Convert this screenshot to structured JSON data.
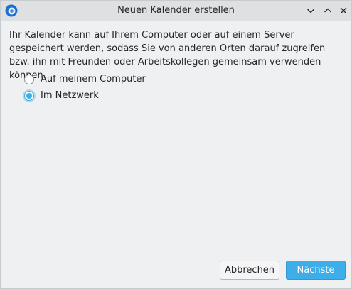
{
  "window": {
    "title": "Neuen Kalender erstellen",
    "app_icon": "thunderbird-icon"
  },
  "titlebar_buttons": {
    "minimize_icon": "chevron-down-icon",
    "maximize_icon": "chevron-up-icon",
    "close_icon": "close-icon"
  },
  "description": "Ihr Kalender kann auf Ihrem Computer oder auf einem Server gespeichert werden, sodass Sie von anderen Orten darauf zugreifen bzw. ihn mit Freunden oder Arbeitskollegen gemeinsam verwenden können.",
  "location_options": [
    {
      "label": "Auf meinem Computer",
      "checked": false
    },
    {
      "label": "Im Netzwerk",
      "checked": true
    }
  ],
  "buttons": {
    "cancel": "Abbrechen",
    "next": "Nächste"
  },
  "colors": {
    "accent": "#3daee9",
    "window_bg": "#eff0f1",
    "titlebar_bg": "#dee0e2"
  }
}
